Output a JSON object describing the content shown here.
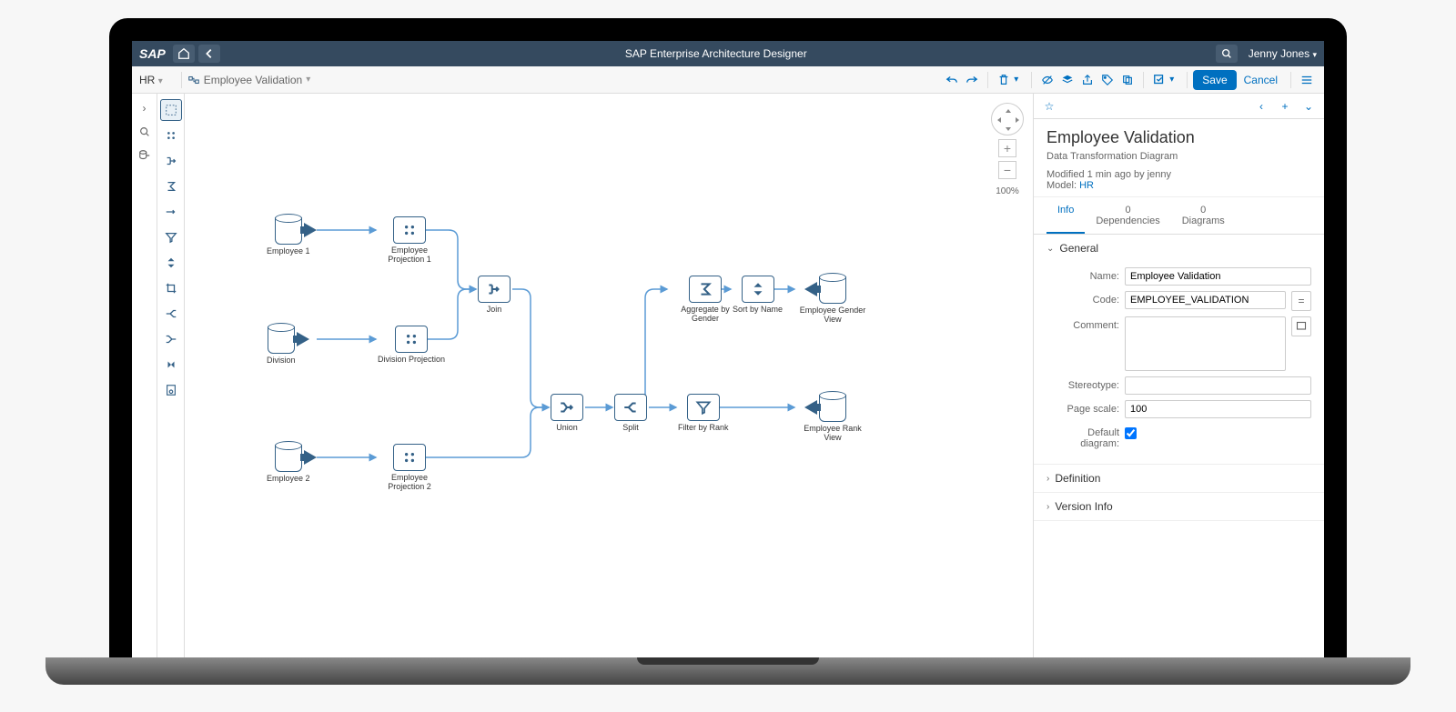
{
  "header": {
    "logo": "SAP",
    "title": "SAP Enterprise Architecture Designer",
    "user": "Jenny Jones"
  },
  "breadcrumb": {
    "context": "HR",
    "diagram": "Employee Validation"
  },
  "toolbar": {
    "save_label": "Save",
    "cancel_label": "Cancel"
  },
  "canvas": {
    "zoom_pct": "100%",
    "nodes": {
      "emp1": "Employee 1",
      "div": "Division",
      "emp2": "Employee 2",
      "empProj1": "Employee Projection 1",
      "divProj": "Division Projection",
      "empProj2": "Employee Projection 2",
      "join": "Join",
      "union": "Union",
      "split": "Split",
      "aggGender": "Aggregate by Gender",
      "sortName": "Sort by Name",
      "filterRank": "Filter by Rank",
      "genderView": "Employee Gender View",
      "rankView": "Employee Rank View"
    }
  },
  "props": {
    "title": "Employee Validation",
    "subtitle": "Data Transformation Diagram",
    "modified": "Modified 1 min ago by jenny",
    "model_label": "Model:",
    "model_link": "HR",
    "tabs": {
      "info": "Info",
      "deps_count": "0",
      "deps_label": "Dependencies",
      "diag_count": "0",
      "diag_label": "Diagrams"
    },
    "section_general": "General",
    "section_definition": "Definition",
    "section_version": "Version Info",
    "fields": {
      "name_label": "Name:",
      "name_value": "Employee Validation",
      "code_label": "Code:",
      "code_value": "EMPLOYEE_VALIDATION",
      "comment_label": "Comment:",
      "comment_value": "",
      "stereotype_label": "Stereotype:",
      "stereotype_value": "",
      "pagescale_label": "Page scale:",
      "pagescale_value": "100",
      "defaultdiag_label": "Default diagram:",
      "eq_symbol": "="
    }
  }
}
